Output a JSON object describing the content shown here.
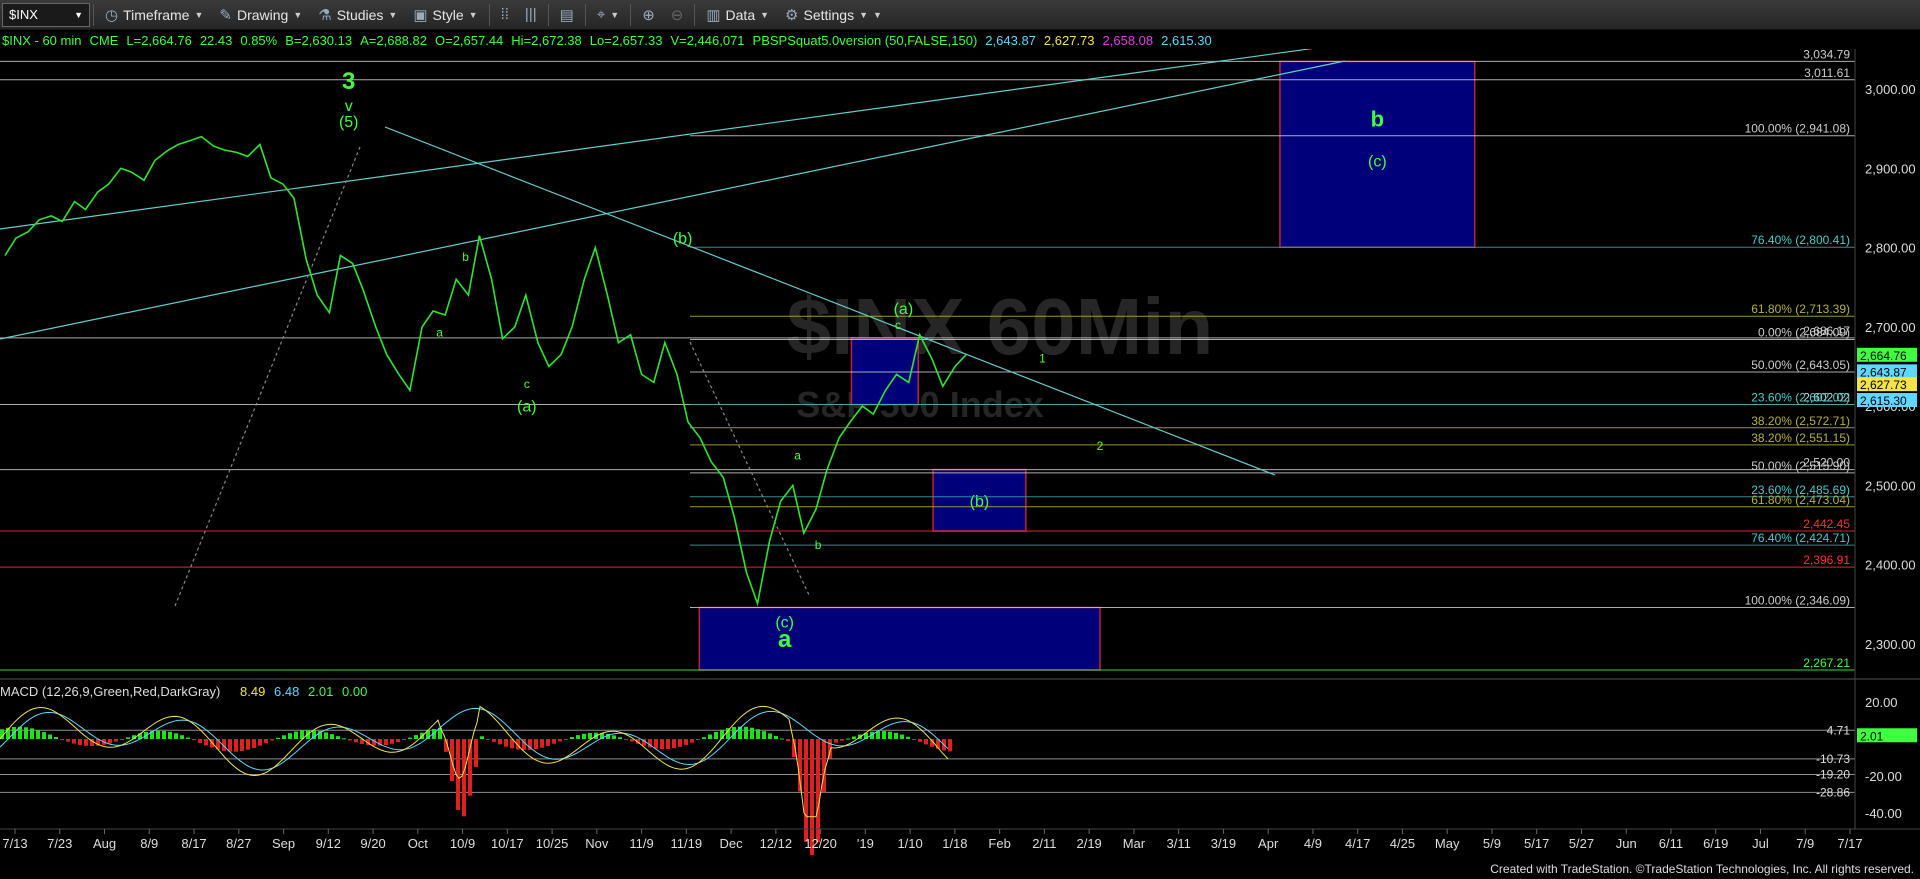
{
  "toolbar": {
    "symbol": "$INX",
    "items": [
      {
        "icon": "clock-icon",
        "label": "Timeframe"
      },
      {
        "icon": "pencil-icon",
        "label": "Drawing"
      },
      {
        "icon": "flask-icon",
        "label": "Studies"
      },
      {
        "icon": "brush-icon",
        "label": "Style"
      }
    ],
    "right_items": [
      {
        "icon": "bar-chart-icon",
        "label": "Data"
      },
      {
        "icon": "gear-icon",
        "label": "Settings"
      }
    ]
  },
  "info": {
    "title": "$INX - 60 min",
    "exchange": "CME",
    "last": "L=2,664.76",
    "change": "22.43",
    "pct": "0.85%",
    "bid": "B=2,630.13",
    "ask": "A=2,688.82",
    "open": "O=2,657.44",
    "high": "Hi=2,672.38",
    "low": "Lo=2,657.33",
    "volume": "V=2,446,071",
    "study": "PBSPSquat5.0version (50,FALSE,150)",
    "study_values": [
      {
        "text": "2,643.87",
        "color": "#5fd7ff"
      },
      {
        "text": "2,627.73",
        "color": "#f2e34a"
      },
      {
        "text": "2,658.08",
        "color": "#e040e0"
      },
      {
        "text": "2,615.30",
        "color": "#5fd7ff"
      }
    ]
  },
  "watermark": {
    "symbol": "$INX 60Min",
    "name": "S&P 500 Index"
  },
  "footer": "Created with TradeStation. ©TradeStation Technologies, Inc. All rights reserved.",
  "chart_data": {
    "type": "line",
    "title": "$INX - 60 min",
    "ylim": [
      2250,
      3050
    ],
    "y_ticks": [
      "3,000.00",
      "2,900.00",
      "2,800.00",
      "2,700.00",
      "2,600.00",
      "2,500.00",
      "2,400.00",
      "2,300.00"
    ],
    "x_ticks": [
      "7/13",
      "7/23",
      "Aug",
      "8/9",
      "8/17",
      "8/27",
      "Sep",
      "9/12",
      "9/20",
      "Oct",
      "10/9",
      "10/17",
      "10/25",
      "Nov",
      "11/9",
      "11/19",
      "Dec",
      "12/12",
      "12/20",
      "'19",
      "1/10",
      "1/18",
      "Feb",
      "2/11",
      "2/19",
      "Mar",
      "3/11",
      "3/19",
      "Apr",
      "4/9",
      "4/17",
      "4/25",
      "May",
      "5/9",
      "5/17",
      "5/27",
      "Jun",
      "6/11",
      "6/19",
      "Jul",
      "7/9",
      "7/17"
    ],
    "price_path": [
      [
        2790,
        2812
      ],
      [
        2820,
        2835
      ],
      [
        2840,
        2833
      ],
      [
        2858,
        2848
      ],
      [
        2870,
        2880
      ],
      [
        2900,
        2895
      ],
      [
        2885,
        2910
      ],
      [
        2922,
        2930
      ],
      [
        2935,
        2940
      ],
      [
        2928,
        2923
      ],
      [
        2920,
        2915
      ],
      [
        2930,
        2888
      ],
      [
        2880,
        2862
      ],
      [
        2785,
        2740
      ],
      [
        2718,
        2790
      ],
      [
        2780,
        2745
      ],
      [
        2700,
        2665
      ],
      [
        2640,
        2620
      ],
      [
        2700,
        2720
      ],
      [
        2715,
        2760
      ],
      [
        2740,
        2815
      ],
      [
        2760,
        2685
      ],
      [
        2700,
        2740
      ],
      [
        2680,
        2650
      ],
      [
        2665,
        2700
      ],
      [
        2760,
        2800
      ],
      [
        2740,
        2680
      ],
      [
        2690,
        2640
      ],
      [
        2630,
        2680
      ],
      [
        2640,
        2580
      ],
      [
        2560,
        2530
      ],
      [
        2510,
        2460
      ],
      [
        2390,
        2351
      ],
      [
        2430,
        2480
      ],
      [
        2500,
        2440
      ],
      [
        2470,
        2520
      ],
      [
        2560,
        2580
      ],
      [
        2600,
        2590
      ],
      [
        2620,
        2640
      ],
      [
        2630,
        2690
      ],
      [
        2660,
        2625
      ],
      [
        2650,
        2664.76
      ]
    ],
    "fib_levels": [
      {
        "label": "3,034.79",
        "y": 3034.79,
        "color": "#cccccc"
      },
      {
        "label": "3,011.61",
        "y": 3011.61,
        "color": "#cccccc"
      },
      {
        "label": "100.00% (2,941.08)",
        "y": 2941.08,
        "color": "#cccccc"
      },
      {
        "label": "76.40% (2,800.41)",
        "y": 2800.41,
        "color": "#3aa6a6"
      },
      {
        "label": "61.80% (2,713.39)",
        "y": 2713.39,
        "color": "#b5b13a"
      },
      {
        "label": "2,686.17",
        "y": 2686.17,
        "color": "#cccccc"
      },
      {
        "label": "0.00% (2,684.09)",
        "y": 2684.09,
        "color": "#cccccc"
      },
      {
        "label": "50.00% (2,643.05)",
        "y": 2643.05,
        "color": "#cccccc"
      },
      {
        "label": "2,602.02",
        "y": 2602.02,
        "color": "#cccccc"
      },
      {
        "label": "23.60% (2,602.02)",
        "y": 2602.02,
        "color": "#3aa6a6"
      },
      {
        "label": "38.20% (2,572.71)",
        "y": 2572.71,
        "color": "#b5b13a"
      },
      {
        "label": "38.20% (2,551.15)",
        "y": 2551.15,
        "color": "#b5b13a"
      },
      {
        "label": "2,520.00",
        "y": 2520.0,
        "color": "#cccccc"
      },
      {
        "label": "50.00% (2,515.90)",
        "y": 2515.9,
        "color": "#cccccc"
      },
      {
        "label": "23.60% (2,485.69)",
        "y": 2485.69,
        "color": "#3aa6a6"
      },
      {
        "label": "61.80% (2,473.04)",
        "y": 2473.04,
        "color": "#b5b13a"
      },
      {
        "label": "2,442.45",
        "y": 2442.45,
        "color": "#ff3030"
      },
      {
        "label": "76.40% (2,424.71)",
        "y": 2424.71,
        "color": "#3aa6a6"
      },
      {
        "label": "2,396.91",
        "y": 2396.91,
        "color": "#ff3030"
      },
      {
        "label": "100.00% (2,346.09)",
        "y": 2346.09,
        "color": "#cccccc"
      },
      {
        "label": "2,267.21",
        "y": 2267.21,
        "color": "#40ff40"
      }
    ],
    "price_tags": [
      {
        "label": "2,664.76",
        "y": 2664.76,
        "bg": "#40ff40",
        "fg": "#000000"
      },
      {
        "label": "2,643.87",
        "y": 2643.87,
        "bg": "#5fd7ff",
        "fg": "#000000"
      },
      {
        "label": "2,627.73",
        "y": 2627.73,
        "bg": "#f2e34a",
        "fg": "#000000"
      },
      {
        "label": "2,615.30",
        "y": 2615.3,
        "bg": "#5fd7ff",
        "fg": "#000000"
      }
    ],
    "target_boxes": [
      {
        "label_top": "b",
        "label_bottom": "(c)",
        "x0": 0.69,
        "x1": 0.795,
        "y_hi": 3034.79,
        "y_lo": 2800.41
      },
      {
        "label_top": "",
        "label_bottom": "",
        "x0": 0.459,
        "x1": 0.495,
        "y_hi": 2686,
        "y_lo": 2602
      },
      {
        "label_top": "",
        "label_bottom": "(b)",
        "x0": 0.503,
        "x1": 0.553,
        "y_hi": 2520,
        "y_lo": 2442.45
      },
      {
        "label_top": "",
        "label_bottom": "",
        "x0": 0.377,
        "x1": 0.593,
        "y_hi": 2346.09,
        "y_lo": 2267.21
      }
    ],
    "wave_labels": [
      {
        "text": "3",
        "x": 0.188,
        "y": 3000,
        "size": "big"
      },
      {
        "text": "v",
        "x": 0.188,
        "y": 2972,
        "size": "mid"
      },
      {
        "text": "(5)",
        "x": 0.188,
        "y": 2952,
        "size": "mid"
      },
      {
        "text": "b",
        "x": 0.251,
        "y": 2783,
        "size": "small"
      },
      {
        "text": "a",
        "x": 0.237,
        "y": 2688,
        "size": "small"
      },
      {
        "text": "c",
        "x": 0.284,
        "y": 2623,
        "size": "small"
      },
      {
        "text": "(a)",
        "x": 0.284,
        "y": 2593,
        "size": "mid"
      },
      {
        "text": "(b)",
        "x": 0.368,
        "y": 2805,
        "size": "mid"
      },
      {
        "text": "(a)",
        "x": 0.487,
        "y": 2716,
        "size": "mid"
      },
      {
        "text": "c",
        "x": 0.484,
        "y": 2697,
        "size": "small"
      },
      {
        "text": "a",
        "x": 0.43,
        "y": 2533,
        "size": "small"
      },
      {
        "text": "b",
        "x": 0.441,
        "y": 2420,
        "size": "small"
      },
      {
        "text": "(c)",
        "x": 0.423,
        "y": 2321,
        "size": "mid"
      },
      {
        "text": "a",
        "x": 0.423,
        "y": 2296,
        "size": "big"
      },
      {
        "text": "1",
        "x": 0.562,
        "y": 2655,
        "size": "small"
      },
      {
        "text": "2",
        "x": 0.593,
        "y": 2545,
        "size": "small"
      }
    ],
    "macd": {
      "title": "MACD (12,26,9,Green,Red,DarkGray)",
      "values": [
        "8.49",
        "6.48",
        "2.01",
        "0.00"
      ],
      "y_ticks": [
        "20.00",
        "-20.00",
        "-40.00"
      ],
      "levels": [
        "4.71",
        "-10.73",
        "-19.20",
        "-28.86"
      ],
      "current": "2.01"
    }
  }
}
